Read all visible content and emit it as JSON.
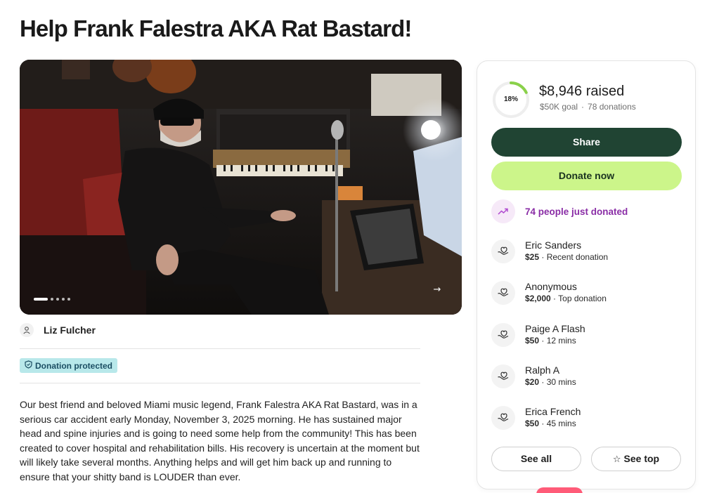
{
  "page": {
    "title": "Help Frank Falestra AKA Rat Bastard!"
  },
  "hero": {
    "image_description": "Man with sunglasses and black cap sitting in a chair in a dim music studio with keyboards, synthesizer and microphone",
    "slide_count": 5,
    "active_slide": 1,
    "next_icon": "arrow-right-icon"
  },
  "organizer": {
    "name": "Liz Fulcher",
    "icon": "person-icon"
  },
  "badge": {
    "label": "Donation protected",
    "icon": "shield-icon"
  },
  "story": {
    "text": "Our best friend and beloved Miami music legend, Frank Falestra AKA Rat Bastard, was in a serious car accident early Monday, November 3, 2025 morning. He has sustained major head and spine injuries and is going to need some help from the community! This has been created to cover hospital and rehabilitation bills. His recovery is uncertain at the moment but will likely take several months. Anything helps and will get him back up and running to ensure that your shitty band is LOUDER than ever."
  },
  "fundraiser": {
    "progress_label": "18%",
    "progress_fraction": 0.18,
    "raised": "$8,946 raised",
    "goal": "$50K goal",
    "donations": "78 donations",
    "share_label": "Share",
    "donate_label": "Donate now",
    "recent_activity": "74 people just donated",
    "donations_list": [
      {
        "name": "Eric Sanders",
        "amount": "$25",
        "detail": " · Recent donation"
      },
      {
        "name": "Anonymous",
        "amount": "$2,000",
        "detail": " · Top donation"
      },
      {
        "name": "Paige A Flash",
        "amount": "$50",
        "detail": " · 12 mins"
      },
      {
        "name": "Ralph A",
        "amount": "$20",
        "detail": " · 30 mins"
      },
      {
        "name": "Erica French",
        "amount": "$50",
        "detail": " · 45 mins"
      }
    ],
    "see_all_label": "See all",
    "see_top_label": "See top"
  },
  "colors": {
    "share_button": "#204433",
    "donate_button": "#ccf58a",
    "progress": "#8ad14a",
    "activity_text": "#8a2da6",
    "badge_bg": "#b8e8ea"
  }
}
